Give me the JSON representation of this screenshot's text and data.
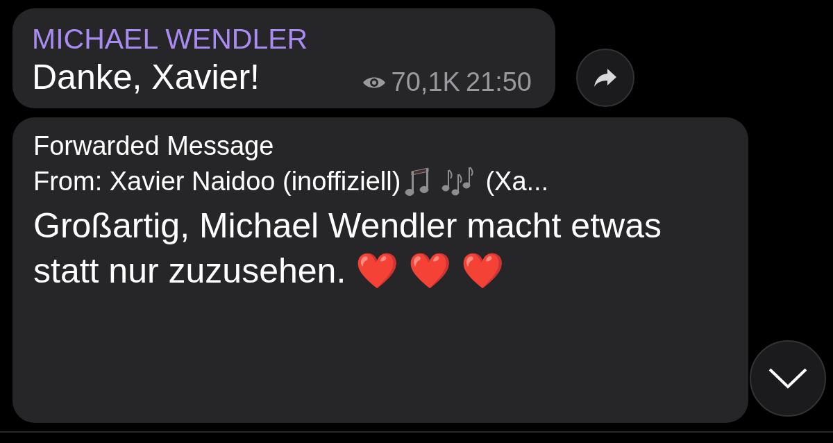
{
  "messages": [
    {
      "kind": "channel",
      "author": "MICHAEL WENDLER",
      "text": "Danke, Xavier!",
      "views": "70,1K",
      "time": "21:50"
    },
    {
      "kind": "forwarded",
      "header": "Forwarded Message",
      "from": "From: Xavier Naidoo (inoffiziell)",
      "from_tail": "(Xa...",
      "text": "Großartig, Michael Wendler macht etwas statt nur zuzusehen.",
      "hearts": [
        "❤️",
        "❤️",
        "❤️"
      ]
    }
  ]
}
